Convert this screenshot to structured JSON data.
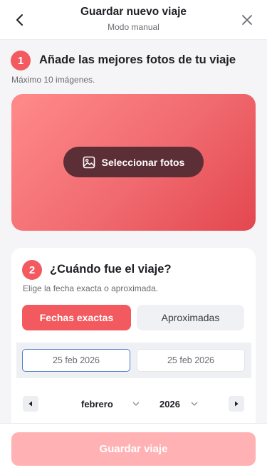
{
  "header": {
    "title": "Guardar nuevo viaje",
    "subtitle": "Modo manual",
    "back_icon": "chevron-left-icon",
    "close_icon": "close-icon"
  },
  "photos": {
    "step_number": "1",
    "title": "Añade las mejores fotos de tu viaje",
    "note": "Máximo 10 imágenes.",
    "select_button_label": "Seleccionar fotos",
    "select_icon": "image-icon"
  },
  "dates": {
    "step_number": "2",
    "title": "¿Cuándo fue el viaje?",
    "note": "Elige la fecha exacta o aproximada.",
    "tabs": [
      {
        "label": "Fechas exactas",
        "active": true
      },
      {
        "label": "Aproximadas",
        "active": false
      }
    ],
    "start_date": "25 feb 2026",
    "end_date": "25 feb 2026",
    "calendar": {
      "month": "febrero",
      "year": "2026"
    }
  },
  "footer": {
    "save_label": "Guardar viaje"
  },
  "colors": {
    "accent": "#f25a5f",
    "select_button_bg": "#5c2f36",
    "save_disabled": "#ffb1b4",
    "active_field_border": "#4b7cc7"
  }
}
